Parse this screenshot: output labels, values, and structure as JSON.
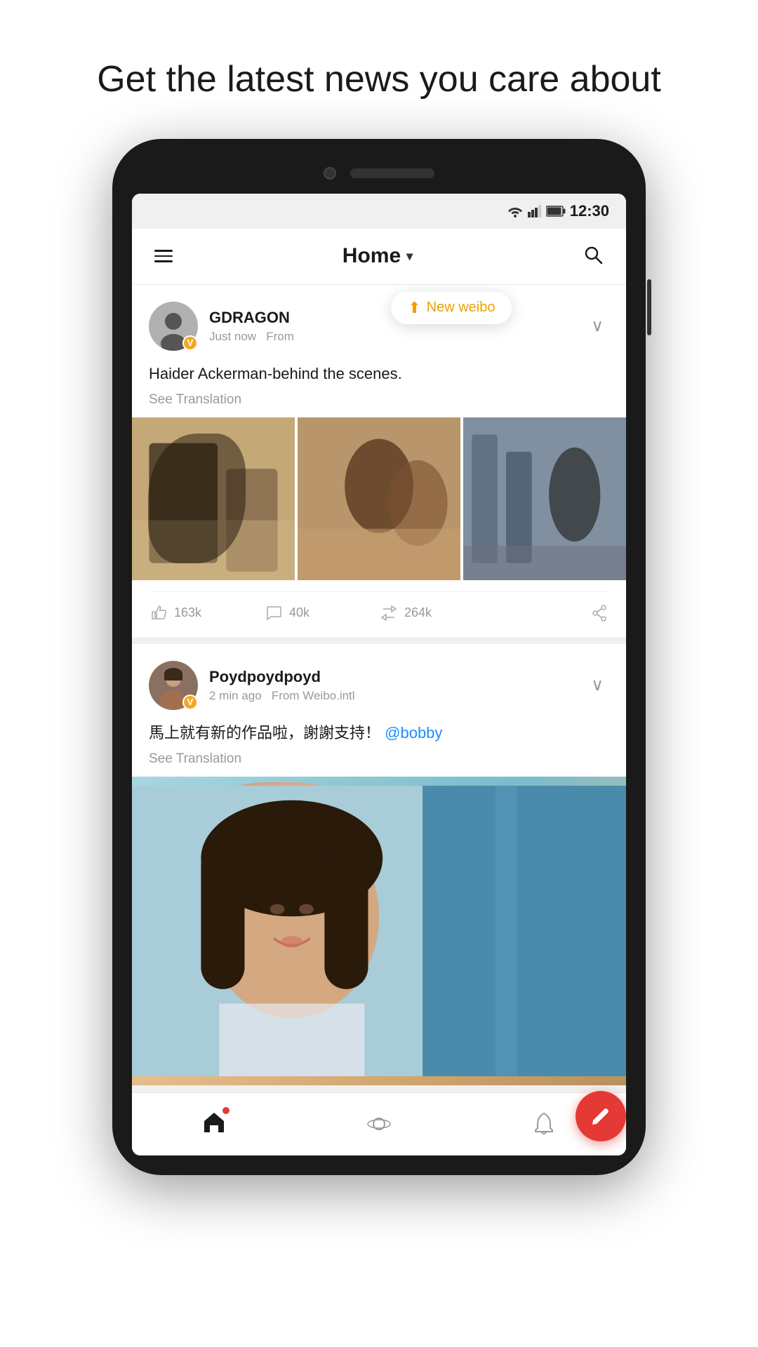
{
  "page": {
    "headline": "Get the latest news you care about"
  },
  "status_bar": {
    "time": "12:30"
  },
  "header": {
    "title": "Home",
    "chevron": "▾",
    "menu_label": "Menu",
    "search_label": "Search"
  },
  "new_weibo_toast": {
    "label": "New weibo"
  },
  "posts": [
    {
      "username": "GDRAGON",
      "time": "Just now",
      "source": "From",
      "content": "Haider Ackerman-behind the scenes.",
      "see_translation": "See Translation",
      "likes": "163k",
      "comments": "40k",
      "reposts": "264k",
      "images": 3
    },
    {
      "username": "Poydpoydpoyd",
      "time": "2 min ago",
      "source": "From Weibo.intl",
      "content": "馬上就有新的作品啦，謝謝支持！",
      "mention": "@bobby",
      "see_translation": "See Translation",
      "images": 1
    }
  ],
  "bottom_nav": {
    "home_label": "Home",
    "discover_label": "Discover",
    "notifications_label": "Notifications"
  },
  "fab": {
    "icon": "edit",
    "label": "Compose"
  }
}
